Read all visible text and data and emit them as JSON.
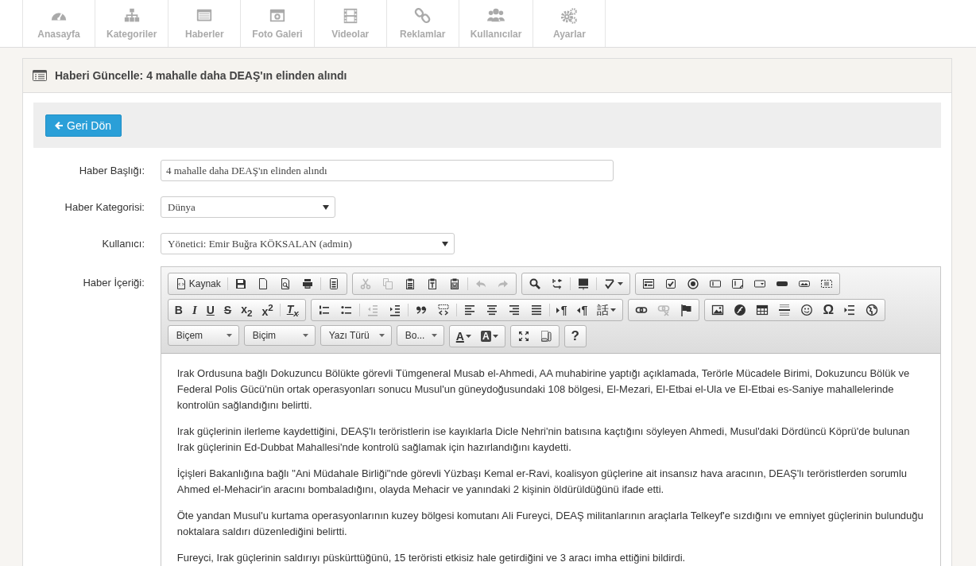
{
  "nav": [
    {
      "label": "Anasayfa"
    },
    {
      "label": "Kategoriler"
    },
    {
      "label": "Haberler"
    },
    {
      "label": "Foto Galeri"
    },
    {
      "label": "Videolar"
    },
    {
      "label": "Reklamlar"
    },
    {
      "label": "Kullanıcılar"
    },
    {
      "label": "Ayarlar"
    }
  ],
  "panel": {
    "title": "Haberi Güncelle: 4 mahalle daha DEAŞ'ın elinden alındı",
    "back_button": "Geri Dön"
  },
  "form": {
    "title_label": "Haber Başlığı:",
    "title_value": "4 mahalle daha DEAŞ'ın elinden alındı",
    "category_label": "Haber Kategorisi:",
    "category_value": "Dünya",
    "user_label": "Kullanıcı:",
    "user_value": "Yönetici: Emir Buğra KÖKSALAN (admin)",
    "content_label": "Haber İçeriği:"
  },
  "toolbar": {
    "rows": [
      {
        "groups": [
          {
            "items": [
              {
                "kind": "source",
                "label": "Kaynak",
                "disabled": false
              },
              {
                "kind": "sep"
              },
              {
                "kind": "save",
                "disabled": false
              },
              {
                "kind": "newpage",
                "disabled": false
              },
              {
                "kind": "preview",
                "disabled": false
              },
              {
                "kind": "print",
                "disabled": false
              },
              {
                "kind": "sep"
              },
              {
                "kind": "templates",
                "disabled": false
              }
            ]
          },
          {
            "items": [
              {
                "kind": "cut",
                "disabled": true
              },
              {
                "kind": "copy",
                "disabled": true
              },
              {
                "kind": "paste",
                "disabled": false
              },
              {
                "kind": "pastetext",
                "disabled": false
              },
              {
                "kind": "pasteword",
                "disabled": false
              },
              {
                "kind": "sep"
              },
              {
                "kind": "undo",
                "disabled": true
              },
              {
                "kind": "redo",
                "disabled": true
              }
            ]
          },
          {
            "items": [
              {
                "kind": "find",
                "disabled": false
              },
              {
                "kind": "replace",
                "disabled": false
              },
              {
                "kind": "sep"
              },
              {
                "kind": "selectall",
                "disabled": false
              },
              {
                "kind": "sep"
              },
              {
                "kind": "spellcheck",
                "disabled": false
              }
            ]
          },
          {
            "items": [
              {
                "kind": "form",
                "disabled": false
              },
              {
                "kind": "checkbox",
                "disabled": false
              },
              {
                "kind": "radio",
                "disabled": false
              },
              {
                "kind": "textfield",
                "disabled": false
              },
              {
                "kind": "textarea",
                "disabled": false
              },
              {
                "kind": "select",
                "disabled": false
              },
              {
                "kind": "button",
                "disabled": false
              },
              {
                "kind": "imagebutton",
                "disabled": false
              },
              {
                "kind": "hiddenfield",
                "disabled": false
              }
            ]
          }
        ]
      },
      {
        "groups": [
          {
            "items": [
              {
                "kind": "bold",
                "label": "B",
                "disabled": false
              },
              {
                "kind": "italic",
                "label": "I",
                "disabled": false
              },
              {
                "kind": "underline",
                "label": "U",
                "disabled": false
              },
              {
                "kind": "strike",
                "label": "S",
                "disabled": false
              },
              {
                "kind": "subscript",
                "label": "x$_{2}$",
                "disabled": false
              },
              {
                "kind": "superscript",
                "label": "x$^{2}$",
                "disabled": false
              },
              {
                "kind": "sep"
              },
              {
                "kind": "removeformat",
                "label": "T$_{x}$",
                "disabled": false
              }
            ]
          },
          {
            "items": [
              {
                "kind": "numlist",
                "disabled": false
              },
              {
                "kind": "bulletlist",
                "disabled": false
              },
              {
                "kind": "sep"
              },
              {
                "kind": "outdent",
                "disabled": true
              },
              {
                "kind": "indent",
                "disabled": false
              },
              {
                "kind": "sep"
              },
              {
                "kind": "blockquote",
                "disabled": false
              },
              {
                "kind": "creatediv",
                "disabled": false
              },
              {
                "kind": "sep"
              },
              {
                "kind": "alignleft",
                "disabled": false
              },
              {
                "kind": "aligncenter",
                "disabled": false
              },
              {
                "kind": "alignright",
                "disabled": false
              },
              {
                "kind": "justify",
                "disabled": false
              },
              {
                "kind": "sep"
              },
              {
                "kind": "ltr",
                "label": "¶",
                "disabled": false
              },
              {
                "kind": "rtl",
                "label": "¶",
                "disabled": false
              },
              {
                "kind": "language",
                "label": "話",
                "disabled": false
              }
            ]
          },
          {
            "items": [
              {
                "kind": "link",
                "disabled": false
              },
              {
                "kind": "unlink",
                "disabled": true
              },
              {
                "kind": "anchor",
                "disabled": false
              }
            ]
          },
          {
            "items": [
              {
                "kind": "image",
                "disabled": false
              },
              {
                "kind": "flash",
                "disabled": false
              },
              {
                "kind": "table",
                "disabled": false
              },
              {
                "kind": "hr",
                "disabled": false
              },
              {
                "kind": "smiley",
                "disabled": false
              },
              {
                "kind": "specialchar",
                "label": "Ω",
                "disabled": false
              },
              {
                "kind": "pagebreak",
                "disabled": false
              },
              {
                "kind": "iframe",
                "disabled": false
              }
            ]
          }
        ]
      },
      {
        "groups": [
          {
            "items": [
              {
                "kind": "combo",
                "label": "Biçem"
              }
            ]
          },
          {
            "items": [
              {
                "kind": "combo",
                "label": "Biçim"
              }
            ]
          },
          {
            "items": [
              {
                "kind": "combo",
                "label": "Yazı Türü"
              }
            ]
          },
          {
            "items": [
              {
                "kind": "combo",
                "label": "Bo..."
              }
            ]
          },
          {
            "items": [
              {
                "kind": "textcolor",
                "label": "A",
                "disabled": false
              },
              {
                "kind": "bgcolor",
                "label": "A",
                "disabled": false
              }
            ]
          },
          {
            "items": [
              {
                "kind": "maximize",
                "disabled": false
              },
              {
                "kind": "showblocks",
                "disabled": false
              }
            ]
          },
          {
            "items": [
              {
                "kind": "about",
                "label": "?",
                "disabled": false
              }
            ]
          }
        ]
      }
    ]
  },
  "content": [
    "Irak Ordusuna bağlı Dokuzuncu Bölükte görevli Tümgeneral Musab el-Ahmedi, AA muhabirine yaptığı açıklamada, Terörle Mücadele Birimi, Dokuzuncu Bölük ve Federal Polis Gücü'nün ortak operasyonları sonucu Musul'un güneydoğusundaki 108 bölgesi, El-Mezari, El-Etbai el-Ula ve El-Etbai es-Saniye mahallelerinde kontrolün sağlandığını belirtti.",
    "Irak güçlerinin ilerleme kaydettiğini, DEAŞ'lı teröristlerin ise kayıklarla Dicle Nehri'nin batısına kaçtığını söyleyen Ahmedi, Musul'daki Dördüncü Köprü'de bulunan Irak güçlerinin Ed-Dubbat Mahallesi'nde kontrolü sağlamak için hazırlandığını kaydetti.",
    "İçişleri Bakanlığına bağlı \"Ani Müdahale Birliği\"nde görevli Yüzbaşı Kemal er-Ravi, koalisyon güçlerine ait insansız hava aracının, DEAŞ'lı teröristlerden sorumlu Ahmed el-Mehacir'in aracını bombaladığını, olayda Mehacir ve yanındaki 2 kişinin öldürüldüğünü ifade etti.",
    "Öte yandan Musul'u kurtama operasyonlarının kuzey bölgesi komutanı Ali Fureyci, DEAŞ militanlarının araçlarla Telkeyf'e sızdığını ve emniyet güçlerinin bulunduğu noktalara saldırı düzenlediğini belirtti.",
    "Fureyci, Irak güçlerinin saldırıyı püskürttüğünü, 15 teröristi etkisiz hale getirdiğini ve 3 aracı imha ettiğini bildirdi."
  ]
}
